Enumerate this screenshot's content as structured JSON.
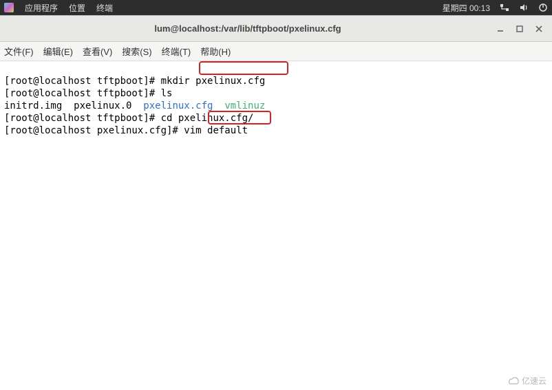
{
  "panel": {
    "apps": "应用程序",
    "places": "位置",
    "terminal": "终端",
    "datetime": "星期四 00:13"
  },
  "window": {
    "title": "lum@localhost:/var/lib/tftpboot/pxelinux.cfg"
  },
  "menu": {
    "file": "文件(F)",
    "edit": "编辑(E)",
    "view": "查看(V)",
    "search": "搜索(S)",
    "terminal": "终端(T)",
    "help": "帮助(H)"
  },
  "term": {
    "p1": "[root@localhost tftpboot]#",
    "c1": " mkdir pxelinux.cfg",
    "p2": "[root@localhost tftpboot]#",
    "c2": " ls",
    "ls1a": "initrd.img  pxelinux.0  ",
    "ls1b": "pxelinux.cfg",
    "ls1sp": "  ",
    "ls1c": "vmlinuz",
    "p3": "[root@localhost tftpboot]#",
    "c3": " cd pxelinux.cfg/",
    "p4": "[root@localhost pxelinux.cfg]#",
    "c4": " vim default"
  },
  "highlight": {
    "h1_arg": "pxelinux.cfg",
    "h2_arg": "default"
  },
  "watermark": "亿速云"
}
